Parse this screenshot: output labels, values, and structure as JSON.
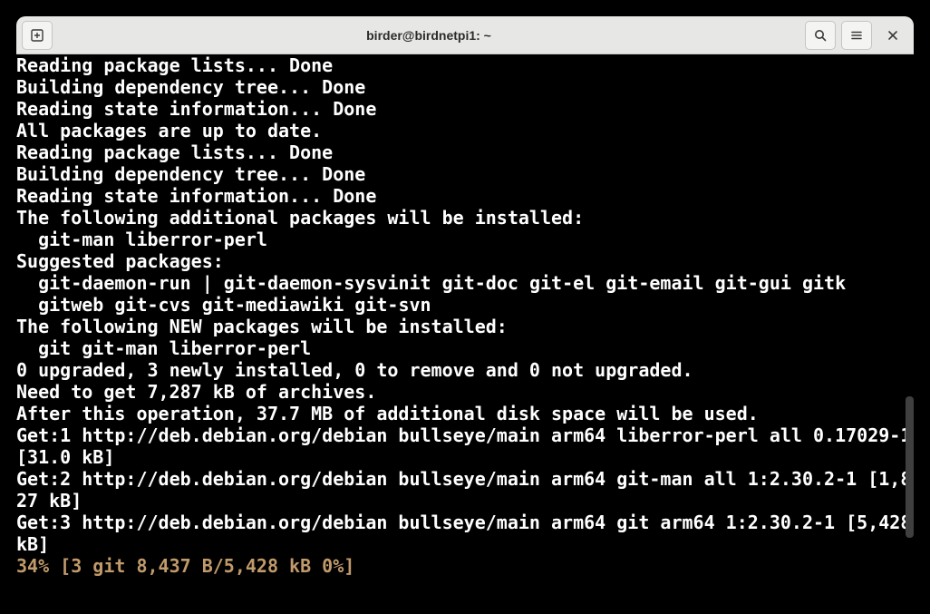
{
  "titlebar": {
    "title": "birder@birdnetpi1: ~"
  },
  "terminal": {
    "lines": [
      "Reading package lists... Done",
      "Building dependency tree... Done",
      "Reading state information... Done",
      "All packages are up to date.",
      "Reading package lists... Done",
      "Building dependency tree... Done",
      "Reading state information... Done",
      "The following additional packages will be installed:",
      "  git-man liberror-perl",
      "Suggested packages:",
      "  git-daemon-run | git-daemon-sysvinit git-doc git-el git-email git-gui gitk",
      "  gitweb git-cvs git-mediawiki git-svn",
      "The following NEW packages will be installed:",
      "  git git-man liberror-perl",
      "0 upgraded, 3 newly installed, 0 to remove and 0 not upgraded.",
      "Need to get 7,287 kB of archives.",
      "After this operation, 37.7 MB of additional disk space will be used.",
      "Get:1 http://deb.debian.org/debian bullseye/main arm64 liberror-perl all 0.17029-1 [31.0 kB]",
      "Get:2 http://deb.debian.org/debian bullseye/main arm64 git-man all 1:2.30.2-1 [1,827 kB]",
      "Get:3 http://deb.debian.org/debian bullseye/main arm64 git arm64 1:2.30.2-1 [5,428 kB]"
    ],
    "progress": "34% [3 git 8,437 B/5,428 kB 0%]"
  }
}
